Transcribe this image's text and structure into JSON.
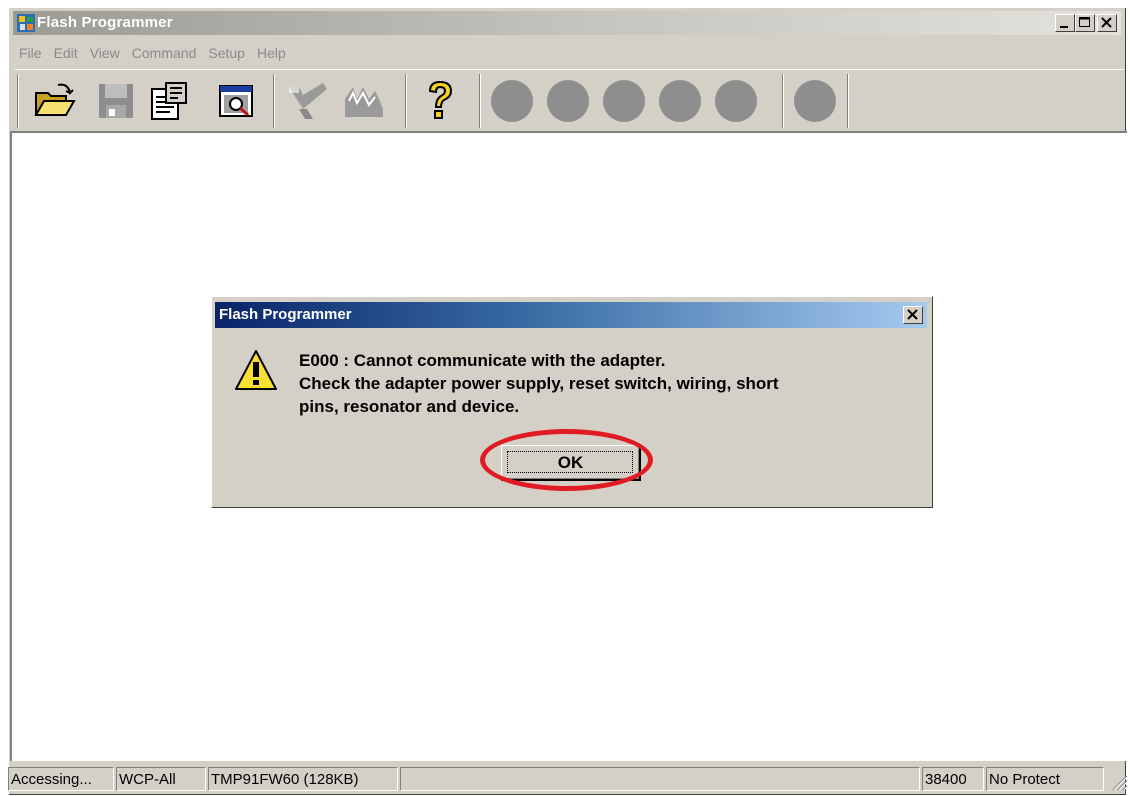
{
  "window": {
    "title": "Flash Programmer",
    "caption_buttons": [
      "minimize",
      "maximize",
      "close"
    ]
  },
  "menu": [
    "File",
    "Edit",
    "View",
    "Command",
    "Setup",
    "Help"
  ],
  "toolbar": {
    "buttons": [
      "open-folder-icon",
      "save-disk-icon",
      "properties-icon",
      "preview-icon",
      "check-icon",
      "waveform-icon",
      "help-question-icon"
    ],
    "status_lights": 6
  },
  "dialog": {
    "title": "Flash Programmer",
    "message_lines": [
      "E000 : Cannot communicate with the adapter.",
      "Check the adapter power supply, reset switch, wiring, short",
      "pins, resonator and device."
    ],
    "ok_label": "OK",
    "icon": "warning-icon"
  },
  "statusbar": {
    "panels": [
      "Accessing...",
      "WCP-All",
      "TMP91FW60 (128KB)",
      "",
      "38400",
      "No Protect"
    ]
  },
  "colors": {
    "highlight": "#e01b24",
    "dialog_title_start": "#0a246a",
    "dialog_title_end": "#a6caf0"
  }
}
